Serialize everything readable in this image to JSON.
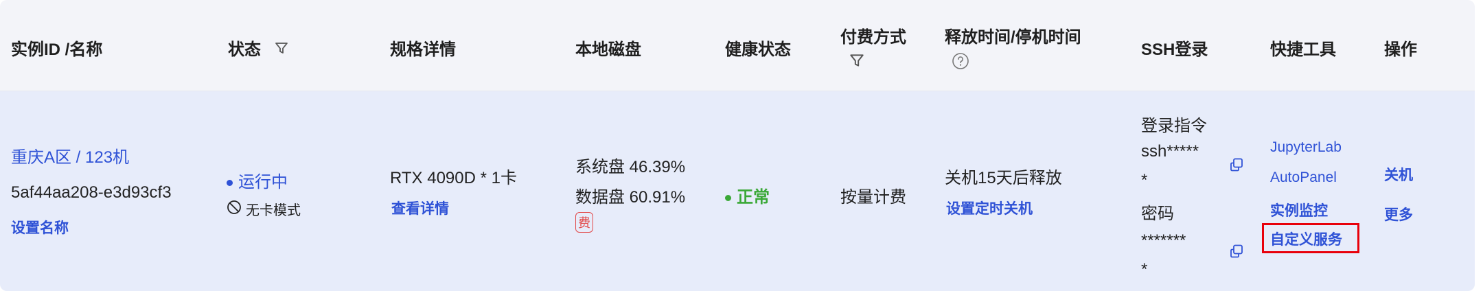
{
  "headers": {
    "instance": "实例ID /名称",
    "status": "状态",
    "spec": "规格详情",
    "disk": "本地磁盘",
    "health": "健康状态",
    "billing": "付费方式",
    "release": "释放时间/停机时间",
    "ssh": "SSH登录",
    "tools": "快捷工具",
    "actions": "操作"
  },
  "row": {
    "instance_name": "重庆A区 / 123机",
    "instance_id": "5af44aa208-e3d93cf3",
    "set_name": "设置名称",
    "status": "运行中",
    "status_color": "#2f52d6",
    "mode": "无卡模式",
    "spec": "RTX 4090D * 1卡",
    "view_details": "查看详情",
    "system_disk": "系统盘 46.39%",
    "data_disk": "数据盘 60.91%",
    "fee_badge": "费",
    "health": "正常",
    "health_color": "#3aa837",
    "billing": "按量计费",
    "release": "关机15天后释放",
    "schedule_shutdown": "设置定时关机",
    "ssh_cmd_label": "登录指令",
    "ssh_cmd_line1": "ssh*****",
    "ssh_cmd_line2": "*",
    "password_label": "密码",
    "password_line1": "*******",
    "password_line2": "*",
    "tool_jupyter": "JupyterLab",
    "tool_autopanel": "AutoPanel",
    "tool_monitor": "实例监控",
    "tool_custom": "自定义服务",
    "action_shutdown": "关机",
    "action_more": "更多"
  },
  "icons": {
    "filter": "filter-icon",
    "help": "help-circle-icon",
    "copy": "copy-icon",
    "no_card": "ban-icon"
  },
  "colors": {
    "link": "#2f52d6",
    "highlight": "#e8000b",
    "fee": "#e24848",
    "header_bg": "#f3f4f9",
    "row_bg": "#e7ecfa"
  }
}
